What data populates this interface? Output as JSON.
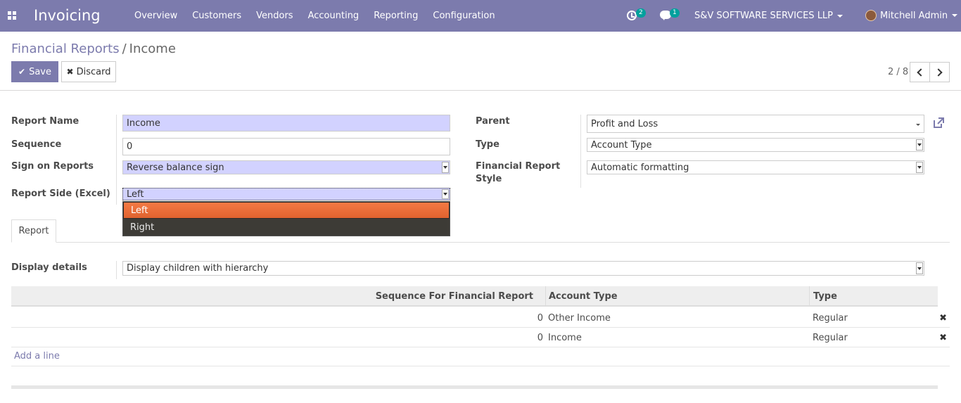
{
  "navbar": {
    "app_title": "Invoicing",
    "menu": [
      "Overview",
      "Customers",
      "Vendors",
      "Accounting",
      "Reporting",
      "Configuration"
    ],
    "activity_count": "2",
    "message_count": "1",
    "company": "S&V SOFTWARE SERVICES LLP",
    "user": "Mitchell Admin",
    "color": "#7c7bad"
  },
  "breadcrumb": {
    "parent": "Financial Reports",
    "separator": "/",
    "current": "Income"
  },
  "buttons": {
    "save": "Save",
    "discard": "Discard"
  },
  "pager": {
    "value": "2 / 8"
  },
  "form": {
    "report_name_label": "Report Name",
    "report_name": "Income",
    "sequence_label": "Sequence",
    "sequence": "0",
    "sign_label": "Sign on Reports",
    "sign": "Reverse balance sign",
    "side_label": "Report Side (Excel)",
    "side": "Left",
    "side_options": [
      "Left",
      "Right"
    ],
    "parent_label": "Parent",
    "parent": "Profit and Loss",
    "type_label": "Type",
    "type": "Account Type",
    "style_label_1": "Financial Report",
    "style_label_2": "Style",
    "style": "Automatic formatting"
  },
  "tabs": {
    "report": "Report"
  },
  "report_tab": {
    "display_label": "Display details",
    "display": "Display children with hierarchy",
    "columns": [
      "Sequence For Financial Report",
      "Account Type",
      "Type"
    ],
    "rows": [
      {
        "sequence": "0",
        "account_type": "Other Income",
        "type": "Regular"
      },
      {
        "sequence": "0",
        "account_type": "Income",
        "type": "Regular"
      }
    ],
    "add_line": "Add a line"
  }
}
